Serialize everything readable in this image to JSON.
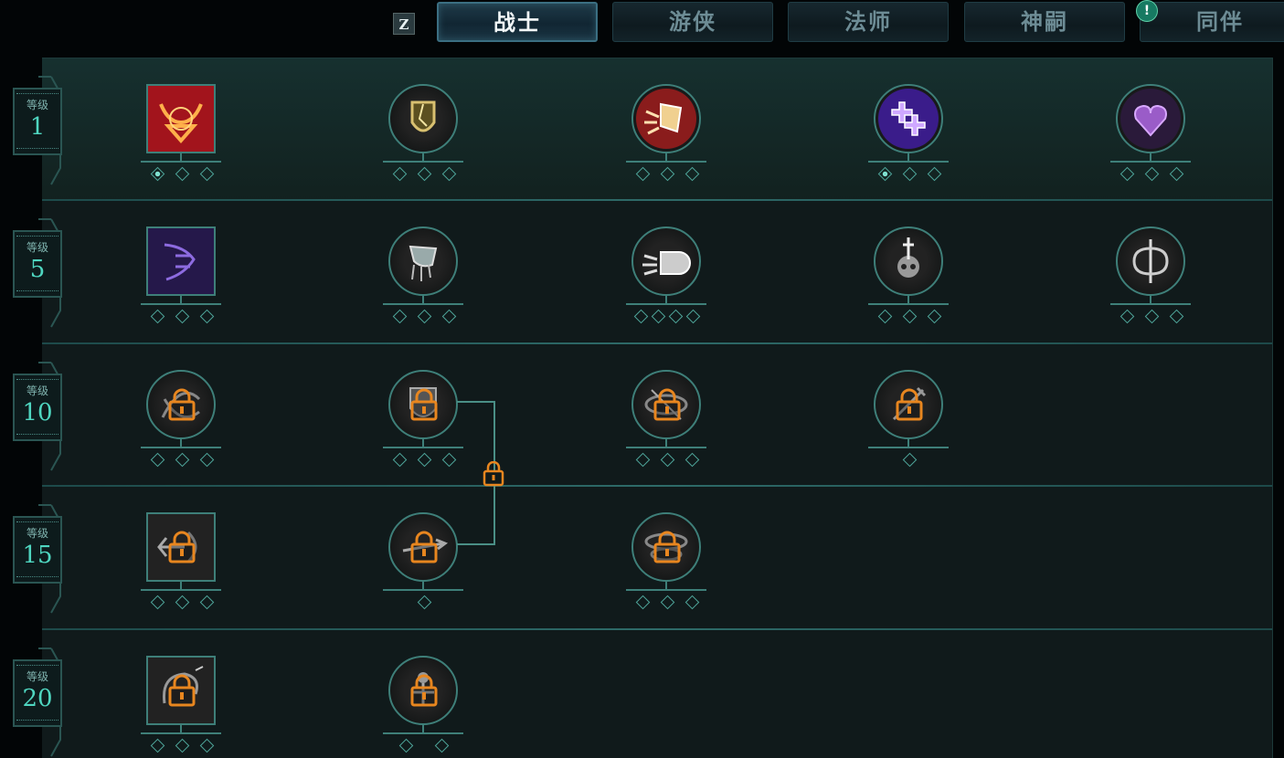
{
  "top_bar": {
    "hotkey": "Z",
    "tabs": [
      {
        "label": "战士",
        "active": true
      },
      {
        "label": "游侠",
        "active": false
      },
      {
        "label": "法师",
        "active": false
      },
      {
        "label": "神嗣",
        "active": false
      },
      {
        "label": "同伴",
        "active": false,
        "alert": "!"
      }
    ]
  },
  "levels": [
    {
      "label": "等级",
      "value": "1"
    },
    {
      "label": "等级",
      "value": "5"
    },
    {
      "label": "等级",
      "value": "10"
    },
    {
      "label": "等级",
      "value": "15"
    },
    {
      "label": "等级",
      "value": "20"
    }
  ],
  "skills": [
    [
      {
        "icon": "bull-head-icon",
        "shape": "square",
        "locked": false,
        "ranks": 3,
        "rank": 1
      },
      {
        "icon": "shield-crack-icon",
        "shape": "circle",
        "locked": false,
        "ranks": 3,
        "rank": 0
      },
      {
        "icon": "shield-bash-icon",
        "shape": "circle",
        "locked": false,
        "ranks": 3,
        "rank": 0
      },
      {
        "icon": "healing-crosses-icon",
        "shape": "circle",
        "locked": false,
        "ranks": 3,
        "rank": 1
      },
      {
        "icon": "heart-icon",
        "shape": "circle",
        "locked": false,
        "ranks": 3,
        "rank": 0
      }
    ],
    [
      {
        "icon": "roaring-face-icon",
        "shape": "square",
        "locked": false,
        "ranks": 3,
        "rank": 0
      },
      {
        "icon": "cleave-axe-icon",
        "shape": "circle",
        "locked": false,
        "ranks": 3,
        "rank": 0
      },
      {
        "icon": "fist-punch-icon",
        "shape": "circle",
        "locked": false,
        "ranks": 4,
        "rank": 0
      },
      {
        "icon": "skull-sword-icon",
        "shape": "circle",
        "locked": false,
        "ranks": 3,
        "rank": 0
      },
      {
        "icon": "double-axe-icon",
        "shape": "circle",
        "locked": false,
        "ranks": 3,
        "rank": 0
      }
    ],
    [
      {
        "icon": "whirlwind-icon",
        "shape": "circle",
        "locked": true,
        "ranks": 3,
        "rank": 0
      },
      {
        "icon": "shield-icon",
        "shape": "circle",
        "locked": true,
        "ranks": 3,
        "rank": 0
      },
      {
        "icon": "vortex-icon",
        "shape": "circle",
        "locked": true,
        "ranks": 3,
        "rank": 0
      },
      {
        "icon": "sword-strike-icon",
        "shape": "circle",
        "locked": true,
        "ranks": 1,
        "rank": 0
      }
    ],
    [
      {
        "icon": "charge-icon",
        "shape": "square",
        "locked": true,
        "ranks": 3,
        "rank": 0
      },
      {
        "icon": "spear-thrust-icon",
        "shape": "circle",
        "locked": true,
        "ranks": 1,
        "rank": 0
      },
      {
        "icon": "tornado-icon",
        "shape": "circle",
        "locked": true,
        "ranks": 3,
        "rank": 0
      }
    ],
    [
      {
        "icon": "spiral-slash-icon",
        "shape": "square",
        "locked": true,
        "ranks": 3,
        "rank": 0
      },
      {
        "icon": "warrior-stance-icon",
        "shape": "circle",
        "locked": true,
        "ranks": 2,
        "rank": 0
      }
    ]
  ],
  "colors": {
    "accent": "#3e7f79",
    "lock": "#e8861f",
    "background": "#101a1b"
  }
}
